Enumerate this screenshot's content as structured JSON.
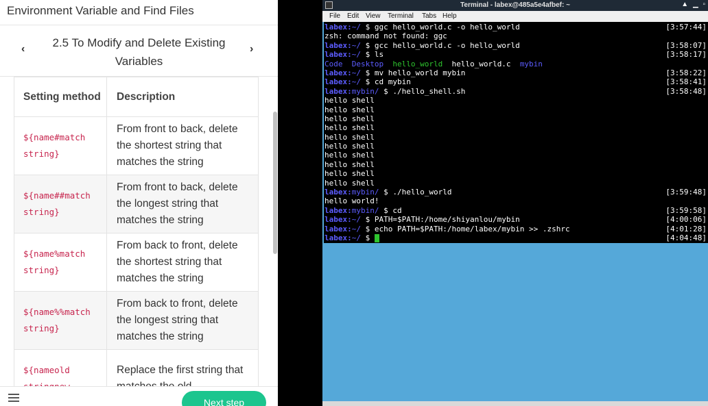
{
  "lab": {
    "title": "Environment Variable and Find Files",
    "section_title": "2.5 To Modify and Delete Existing Variables",
    "prev_label": "‹",
    "next_label": "›",
    "next_step_label": "Next step",
    "table": {
      "headers": [
        "Setting method",
        "Description"
      ],
      "rows": [
        {
          "method": "${name#match string}",
          "description": "From front to back, delete the shortest string that matches the string"
        },
        {
          "method": "${name##match string}",
          "description": "From front to back, delete the longest string that matches the string"
        },
        {
          "method": "${name%match string}",
          "description": "From back to front, delete the shortest string that matches the string"
        },
        {
          "method": "${name%%match string}",
          "description": "From back to front, delete the longest string that matches the string"
        },
        {
          "method": "${nameold stringnew",
          "description": "Replace the first string that matches the old"
        }
      ]
    }
  },
  "terminal": {
    "title": "Terminal - labex@485a5e4afbef: ~",
    "menus": [
      "File",
      "Edit",
      "View",
      "Terminal",
      "Tabs",
      "Help"
    ],
    "lines": [
      {
        "parts": [
          {
            "t": "labex:",
            "c": "pu"
          },
          {
            "t": "~/",
            "c": "bl"
          },
          {
            "t": " $ ggc hello_world.c -o hello_world",
            "c": ""
          }
        ],
        "time": "[3:57:44]"
      },
      {
        "parts": [
          {
            "t": "zsh: command not found: ggc",
            "c": ""
          }
        ],
        "time": ""
      },
      {
        "parts": [
          {
            "t": "labex:",
            "c": "pu"
          },
          {
            "t": "~/",
            "c": "bl"
          },
          {
            "t": " $ gcc hello_world.c -o hello_world",
            "c": ""
          }
        ],
        "time": "[3:58:07]"
      },
      {
        "parts": [
          {
            "t": "labex:",
            "c": "pu"
          },
          {
            "t": "~/",
            "c": "bl"
          },
          {
            "t": " $ ls",
            "c": ""
          }
        ],
        "time": "[3:58:17]"
      },
      {
        "parts": [
          {
            "t": "Code",
            "c": "bl"
          },
          {
            "t": "  ",
            "c": ""
          },
          {
            "t": "Desktop",
            "c": "bl"
          },
          {
            "t": "  ",
            "c": ""
          },
          {
            "t": "hello_world",
            "c": "gr"
          },
          {
            "t": "  hello_world.c  ",
            "c": ""
          },
          {
            "t": "mybin",
            "c": "bl"
          }
        ],
        "time": ""
      },
      {
        "parts": [
          {
            "t": "labex:",
            "c": "pu"
          },
          {
            "t": "~/",
            "c": "bl"
          },
          {
            "t": " $ mv hello_world mybin",
            "c": ""
          }
        ],
        "time": "[3:58:22]"
      },
      {
        "parts": [
          {
            "t": "labex:",
            "c": "pu"
          },
          {
            "t": "~/",
            "c": "bl"
          },
          {
            "t": " $ cd mybin",
            "c": ""
          }
        ],
        "time": "[3:58:41]"
      },
      {
        "parts": [
          {
            "t": "labex:",
            "c": "pu"
          },
          {
            "t": "mybin/",
            "c": "bl"
          },
          {
            "t": " $ ./hello_shell.sh",
            "c": ""
          }
        ],
        "time": "[3:58:48]"
      },
      {
        "parts": [
          {
            "t": "hello shell",
            "c": ""
          }
        ],
        "time": ""
      },
      {
        "parts": [
          {
            "t": "hello shell",
            "c": ""
          }
        ],
        "time": ""
      },
      {
        "parts": [
          {
            "t": "hello shell",
            "c": ""
          }
        ],
        "time": ""
      },
      {
        "parts": [
          {
            "t": "hello shell",
            "c": ""
          }
        ],
        "time": ""
      },
      {
        "parts": [
          {
            "t": "hello shell",
            "c": ""
          }
        ],
        "time": ""
      },
      {
        "parts": [
          {
            "t": "hello shell",
            "c": ""
          }
        ],
        "time": ""
      },
      {
        "parts": [
          {
            "t": "hello shell",
            "c": ""
          }
        ],
        "time": ""
      },
      {
        "parts": [
          {
            "t": "hello shell",
            "c": ""
          }
        ],
        "time": ""
      },
      {
        "parts": [
          {
            "t": "hello shell",
            "c": ""
          }
        ],
        "time": ""
      },
      {
        "parts": [
          {
            "t": "hello shell",
            "c": ""
          }
        ],
        "time": ""
      },
      {
        "parts": [
          {
            "t": "labex:",
            "c": "pu"
          },
          {
            "t": "mybin/",
            "c": "bl"
          },
          {
            "t": " $ ./hello_world",
            "c": ""
          }
        ],
        "time": "[3:59:48]"
      },
      {
        "parts": [
          {
            "t": "hello world!",
            "c": ""
          }
        ],
        "time": ""
      },
      {
        "parts": [
          {
            "t": "labex:",
            "c": "pu"
          },
          {
            "t": "mybin/",
            "c": "bl"
          },
          {
            "t": " $ cd",
            "c": ""
          }
        ],
        "time": "[3:59:58]"
      },
      {
        "parts": [
          {
            "t": "labex:",
            "c": "pu"
          },
          {
            "t": "~/",
            "c": "bl"
          },
          {
            "t": " $ PATH=$PATH:/home/shiyanlou/mybin",
            "c": ""
          }
        ],
        "time": "[4:00:06]"
      },
      {
        "parts": [
          {
            "t": "labex:",
            "c": "pu"
          },
          {
            "t": "~/",
            "c": "bl"
          },
          {
            "t": " $ echo PATH=$PATH:/home/labex/mybin >> .zshrc",
            "c": ""
          }
        ],
        "time": "[4:01:28]"
      },
      {
        "parts": [
          {
            "t": "labex:",
            "c": "pu"
          },
          {
            "t": "~/",
            "c": "bl"
          },
          {
            "t": " $ ",
            "c": ""
          }
        ],
        "time": "[4:04:48]",
        "cursor": true
      }
    ]
  },
  "colors": {
    "accent": "#1cc58e",
    "code": "#c7254e",
    "prompt": "#5c5cff",
    "exec": "#2ec42e",
    "desktop": "#55a8d9"
  }
}
